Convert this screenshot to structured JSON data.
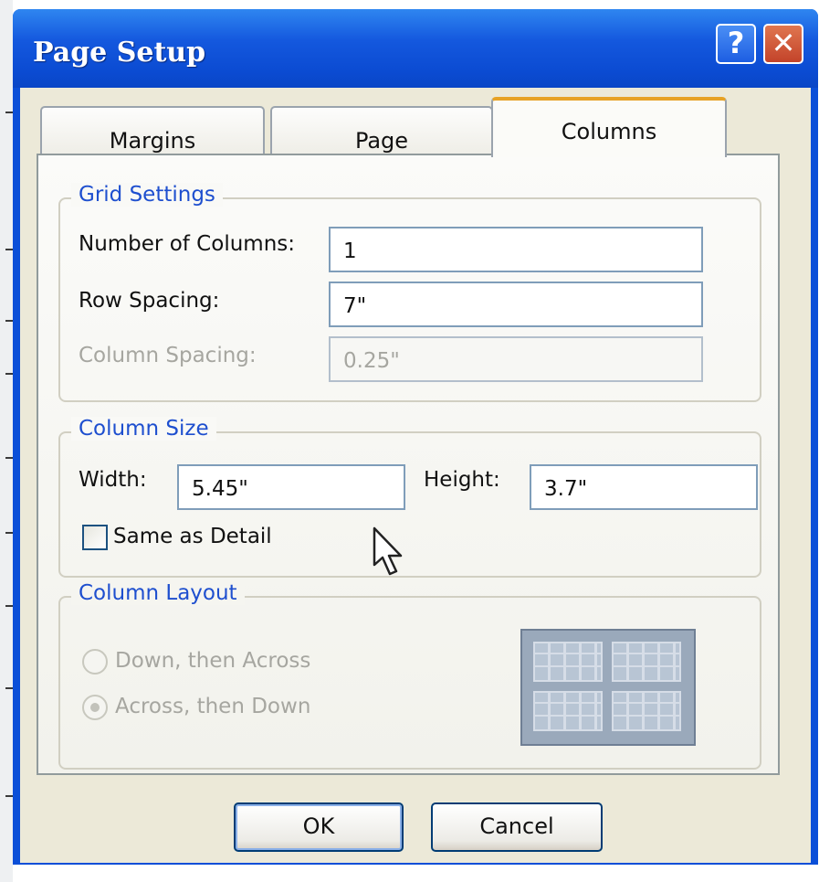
{
  "window": {
    "title": "Page Setup",
    "help_button": "?",
    "close_button": "✕"
  },
  "tabs": [
    {
      "label": "Margins",
      "active": false
    },
    {
      "label": "Page",
      "active": false
    },
    {
      "label": "Columns",
      "active": true
    }
  ],
  "grid_settings": {
    "legend": "Grid Settings",
    "number_of_columns": {
      "label": "Number of Columns:",
      "value": "1"
    },
    "row_spacing": {
      "label": "Row Spacing:",
      "value": "7\""
    },
    "column_spacing": {
      "label": "Column Spacing:",
      "value": "0.25\"",
      "disabled": true
    }
  },
  "column_size": {
    "legend": "Column Size",
    "width": {
      "label": "Width:",
      "value": "5.45\""
    },
    "height": {
      "label": "Height:",
      "value": "3.7\""
    },
    "same_as_detail": {
      "label": "Same as Detail",
      "checked": false
    }
  },
  "column_layout": {
    "legend": "Column Layout",
    "options": [
      {
        "label": "Down, then Across",
        "selected": false,
        "disabled": true
      },
      {
        "label": "Across, then Down",
        "selected": true,
        "disabled": true
      }
    ],
    "preview_icon": "column-layout-preview-icon"
  },
  "buttons": {
    "ok": "OK",
    "cancel": "Cancel"
  },
  "colors": {
    "title_bar": "#0b4fd8",
    "legend_text": "#1e4fcf",
    "active_tab_accent": "#e7a225",
    "close_button": "#c3432a"
  }
}
